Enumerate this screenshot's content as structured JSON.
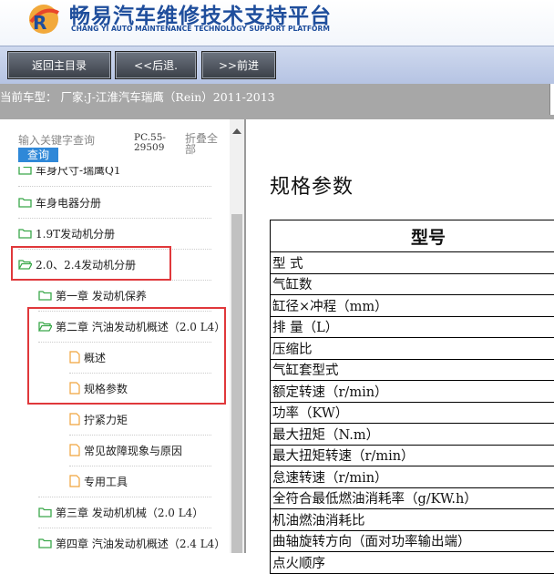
{
  "header": {
    "title_cn": "畅易汽车维修技术支持平台",
    "title_en": "CHANG YI AUTO MAINTENANCE TECHNOLOGY SUPPORT PLATFORM",
    "logo_icon": "cy-logo-icon"
  },
  "nav": {
    "home_label": "返回主目录",
    "back_label": "<<后退.",
    "forward_label": ">>前进"
  },
  "current_model": {
    "text": "当前车型： 厂家:J-江淮汽车瑞鹰（Rein）2011-2013"
  },
  "sidebar": {
    "search_placeholder": "输入关键字查询",
    "search_button": "查询",
    "pc_code": "PC.55-29509",
    "collapse_all": "折叠全部",
    "tree": [
      {
        "label": "车身尺寸-瑞鹰Q1",
        "type": "folder"
      },
      {
        "label": "车身电器分册",
        "type": "folder"
      },
      {
        "label": "1.9T发动机分册",
        "type": "folder"
      },
      {
        "label": "2.0、2.4发动机分册",
        "type": "folder-open"
      },
      {
        "label": "第一章 发动机保养",
        "type": "folder"
      },
      {
        "label": "第二章 汽油发动机概述（2.0 L4）",
        "type": "folder-open"
      },
      {
        "label": "概述",
        "type": "file"
      },
      {
        "label": "规格参数",
        "type": "file"
      },
      {
        "label": "拧紧力矩",
        "type": "file"
      },
      {
        "label": "常见故障现象与原因",
        "type": "file"
      },
      {
        "label": "专用工具",
        "type": "file"
      },
      {
        "label": "第三章 发动机机械（2.0 L4）",
        "type": "folder"
      },
      {
        "label": "第四章 汽油发动机概述（2.4 L4）",
        "type": "folder"
      }
    ]
  },
  "main": {
    "title": "规格参数",
    "table_header": "型号",
    "rows": [
      "型 式",
      "气缸数",
      "缸径×冲程（mm）",
      "排 量（L）",
      "压缩比",
      "气缸套型式",
      "额定转速（r/min）",
      "功率（KW）",
      "最大扭矩（N.m）",
      "最大扭矩转速（r/min）",
      "怠速转速（r/min）",
      "全符合最低燃油消耗率（g/KW.h）",
      "机油燃油消耗比",
      "曲轴旋转方向（面对功率输出端）",
      "点火顺序"
    ]
  },
  "colors": {
    "brand_blue": "#1f4e9c",
    "highlight_red": "#e0383b",
    "folder_green": "#3aa84a",
    "file_orange": "#f0a43c"
  }
}
